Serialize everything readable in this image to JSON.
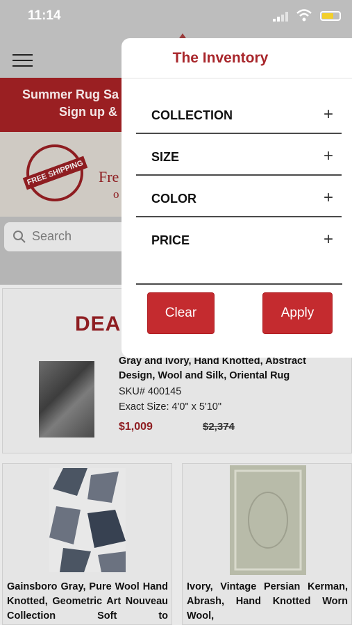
{
  "status": {
    "time": "11:14"
  },
  "banner": {
    "line1": "Summer Rug Sa",
    "line2": "Sign up &"
  },
  "shipping": {
    "stamp": "FREE SHIPPING",
    "text": "Fre",
    "sub": "o"
  },
  "search": {
    "placeholder": "Search"
  },
  "deal": {
    "title": "DEA",
    "product_name": "Gray and Ivory, Hand Knotted, Abstract Design, Wool and Silk, Oriental Rug",
    "sku": "SKU# 400145",
    "size": "Exact Size: 4'0\" x 5'10\"",
    "price": "$1,009",
    "old_price": "$2,374"
  },
  "products": [
    {
      "description": "Gainsboro Gray, Pure Wool Hand Knotted, Geometric Art Nouveau Collection Soft to"
    },
    {
      "description": "Ivory, Vintage Persian Kerman, Abrash, Hand Knotted Worn Wool,"
    }
  ],
  "panel": {
    "title": "The Inventory",
    "filters": [
      "COLLECTION",
      "SIZE",
      "COLOR",
      "PRICE"
    ],
    "plus": "+",
    "clear": "Clear",
    "apply": "Apply"
  },
  "colors": {
    "brand": "#a8262b",
    "button": "#c42b2f"
  }
}
